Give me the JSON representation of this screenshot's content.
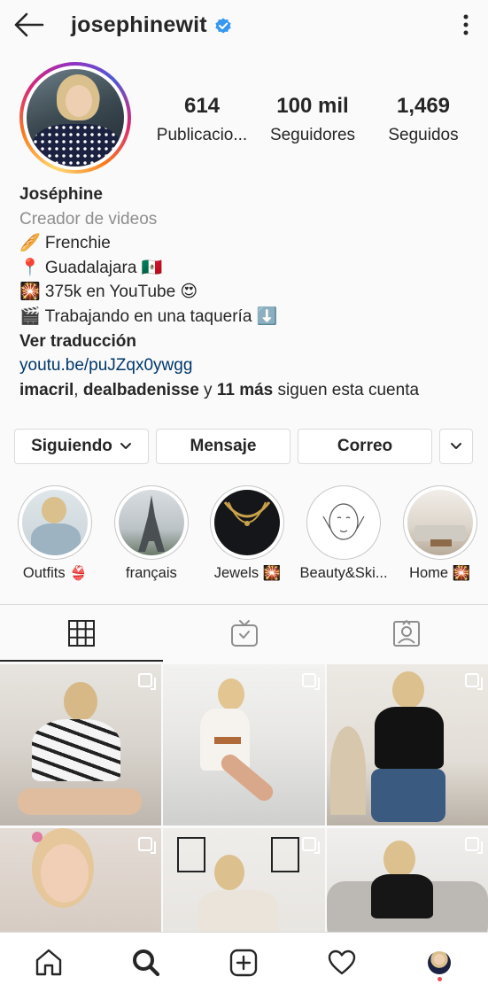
{
  "header": {
    "username": "josephinewit",
    "verified": true,
    "back_icon": "arrow-left-icon",
    "menu_icon": "kebab-icon"
  },
  "stats": {
    "posts": {
      "value": "614",
      "label": "Publicacio..."
    },
    "followers": {
      "value": "100 mil",
      "label": "Seguidores"
    },
    "following": {
      "value": "1,469",
      "label": "Seguidos"
    }
  },
  "bio": {
    "name": "Joséphine",
    "category": "Creador de videos",
    "lines": [
      "🥖 Frenchie",
      "📍 Guadalajara 🇲🇽",
      "🎇 375k en YouTube 😍",
      "🎬 Trabajando en una taquería ⬇️"
    ],
    "translate": "Ver traducción",
    "link": "youtu.be/puJZqx0ywgg",
    "followed_by": {
      "user1": "imacril",
      "sep": ", ",
      "user2": "dealbadenisse",
      "and": " y ",
      "others": "11 más",
      "suffix": " siguen esta cuenta"
    }
  },
  "actions": {
    "following": "Siguiendo",
    "message": "Mensaje",
    "email": "Correo"
  },
  "highlights": [
    {
      "label": "Outfits 👙"
    },
    {
      "label": "français"
    },
    {
      "label": "Jewels 🎇"
    },
    {
      "label": "Beauty&Ski..."
    },
    {
      "label": "Home 🎇"
    }
  ],
  "tabs": [
    {
      "icon": "grid-icon",
      "active": true
    },
    {
      "icon": "igtv-icon",
      "active": false
    },
    {
      "icon": "tagged-icon",
      "active": false
    }
  ],
  "colors": {
    "accent_link": "#00376b",
    "verified": "#3897f0",
    "secondary_text": "#8e8e8e",
    "notification": "#ed4956"
  },
  "bottom_nav": [
    "home-icon",
    "search-icon",
    "add-post-icon",
    "heart-icon",
    "profile-avatar"
  ]
}
